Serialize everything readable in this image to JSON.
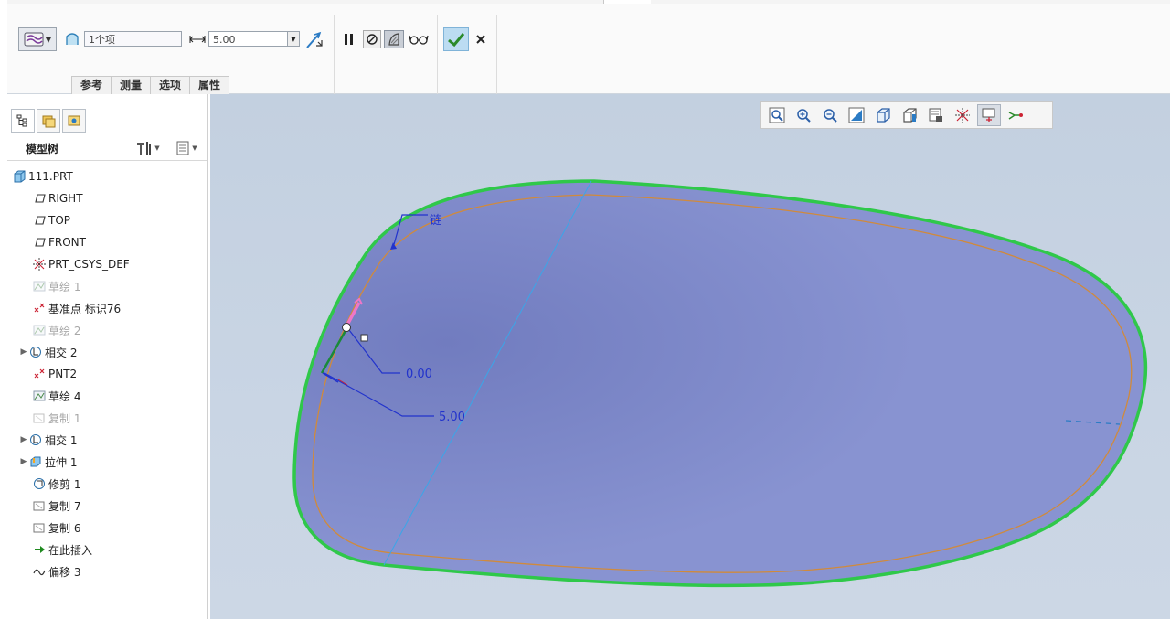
{
  "dashboard": {
    "references_field": "1个项",
    "offset_value": "5.00",
    "tabs": [
      "参考",
      "测量",
      "选项",
      "属性"
    ]
  },
  "model_tree": {
    "title": "模型树",
    "items": [
      {
        "label": "111.PRT",
        "icon": "part-icon",
        "expand": false,
        "dim": false,
        "indent": 0
      },
      {
        "label": "RIGHT",
        "icon": "datum-plane-icon",
        "expand": false,
        "dim": false,
        "indent": 1
      },
      {
        "label": "TOP",
        "icon": "datum-plane-icon",
        "expand": false,
        "dim": false,
        "indent": 1
      },
      {
        "label": "FRONT",
        "icon": "datum-plane-icon",
        "expand": false,
        "dim": false,
        "indent": 1
      },
      {
        "label": "PRT_CSYS_DEF",
        "icon": "csys-icon",
        "expand": false,
        "dim": false,
        "indent": 1
      },
      {
        "label": "草绘 1",
        "icon": "sketch-icon",
        "expand": false,
        "dim": true,
        "indent": 1
      },
      {
        "label": "基准点 标识76",
        "icon": "datum-point-icon",
        "expand": false,
        "dim": false,
        "indent": 1
      },
      {
        "label": "草绘 2",
        "icon": "sketch-icon",
        "expand": false,
        "dim": true,
        "indent": 1
      },
      {
        "label": "相交 2",
        "icon": "intersect-icon",
        "expand": true,
        "dim": false,
        "indent": 1
      },
      {
        "label": "PNT2",
        "icon": "datum-point-icon",
        "expand": false,
        "dim": false,
        "indent": 1
      },
      {
        "label": "草绘 4",
        "icon": "sketch-icon",
        "expand": false,
        "dim": false,
        "indent": 1
      },
      {
        "label": "复制 1",
        "icon": "copy-icon",
        "expand": false,
        "dim": true,
        "indent": 1
      },
      {
        "label": "相交 1",
        "icon": "intersect-icon",
        "expand": true,
        "dim": false,
        "indent": 1
      },
      {
        "label": "拉伸 1",
        "icon": "extrude-icon",
        "expand": true,
        "dim": false,
        "indent": 1
      },
      {
        "label": "修剪 1",
        "icon": "trim-icon",
        "expand": false,
        "dim": false,
        "indent": 1
      },
      {
        "label": "复制 7",
        "icon": "copy-icon",
        "expand": false,
        "dim": false,
        "indent": 1
      },
      {
        "label": "复制 6",
        "icon": "copy-icon",
        "expand": false,
        "dim": false,
        "indent": 1
      },
      {
        "label": "在此插入",
        "icon": "insert-here-icon",
        "expand": false,
        "dim": false,
        "indent": 1
      },
      {
        "label": "偏移 3",
        "icon": "offset-icon",
        "expand": false,
        "dim": false,
        "indent": 1
      }
    ]
  },
  "graphics": {
    "chain_label": "链",
    "dim_start": "0.00",
    "dim_end": "5.00"
  },
  "colors": {
    "surface": "#8590cc",
    "edge_green": "#2fc84a",
    "offset_curve": "#d08a3c",
    "annotation": "#2233cc",
    "confirm": "#2a8a2a"
  }
}
